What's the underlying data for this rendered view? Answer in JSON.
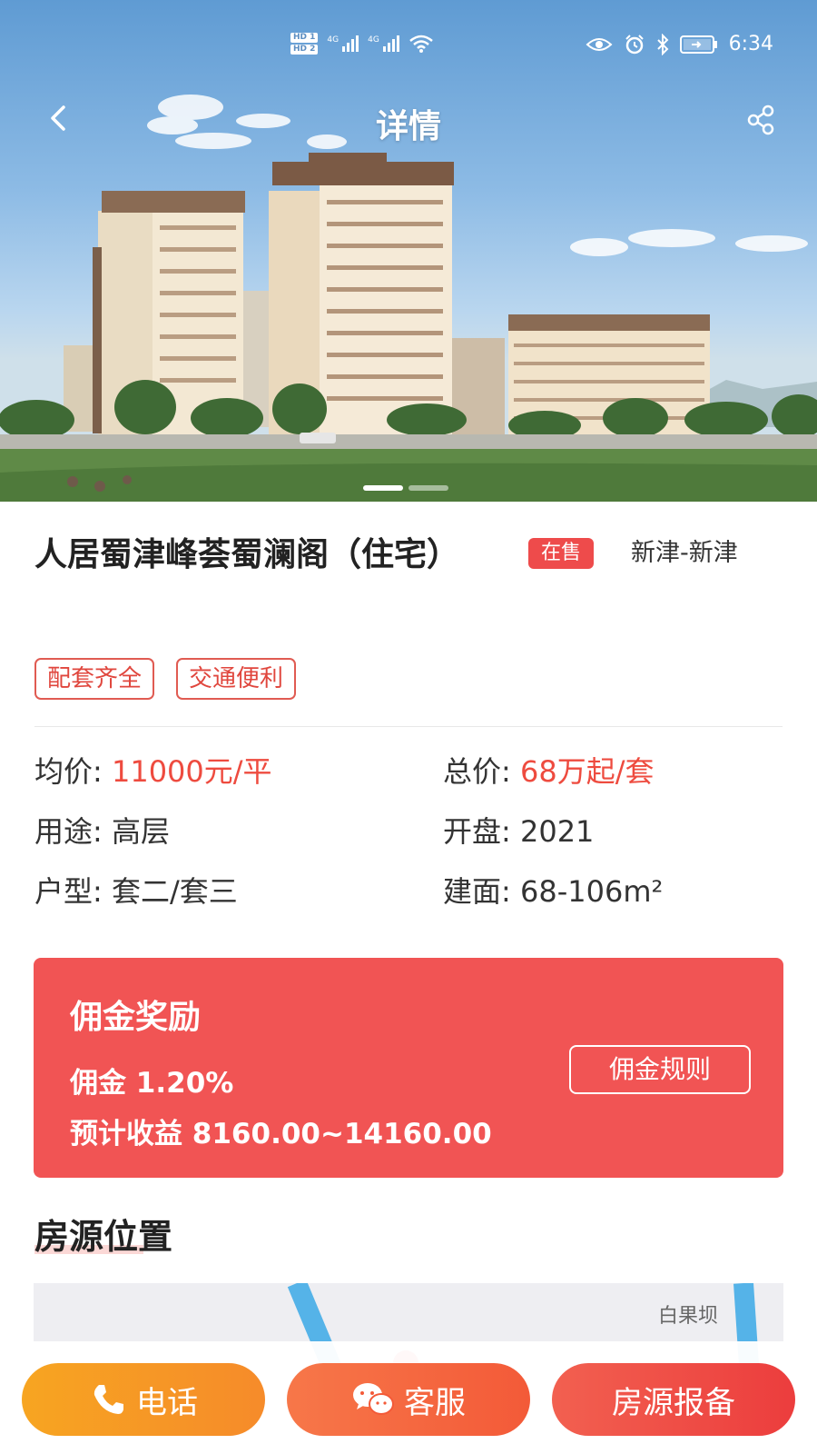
{
  "status_bar": {
    "hd1": "HD 1",
    "hd2": "HD 2",
    "net1": "4G",
    "net2": "4G",
    "time": "6:34"
  },
  "header": {
    "title": "详情",
    "back_icon": "chevron-left-icon",
    "share_icon": "share-icon"
  },
  "carousel": {
    "slide_count": 2,
    "active_index": 0
  },
  "property": {
    "name": "人居蜀津峰荟蜀澜阁（住宅）",
    "status": "在售",
    "region": "新津-新津",
    "tags": [
      "配套齐全",
      "交通便利"
    ]
  },
  "specs": {
    "avg_price": {
      "label": "均价: ",
      "value": "11000元/平"
    },
    "total_price": {
      "label": "总价: ",
      "value": "68万起/套"
    },
    "usage": {
      "label": "用途: ",
      "value": "高层"
    },
    "opening": {
      "label": "开盘: ",
      "value": "2021"
    },
    "layout": {
      "label": "户型: ",
      "value": "套二/套三"
    },
    "area": {
      "label": "建面: ",
      "value": "68-106m²"
    }
  },
  "commission": {
    "title": "佣金奖励",
    "rate": "佣金 1.20%",
    "expected": "预计收益 8160.00~14160.00",
    "rules_button": "佣金规则"
  },
  "location": {
    "title": "房源位置",
    "map_place": "白果坝"
  },
  "actions": {
    "call": "电话",
    "service": "客服",
    "report": "房源报备"
  },
  "colors": {
    "accent_red": "#f15454",
    "price_red": "#ee4b3f",
    "call_orange": "#f7a521",
    "service_orange": "#f35a38",
    "report_red": "#ec3d3d"
  }
}
